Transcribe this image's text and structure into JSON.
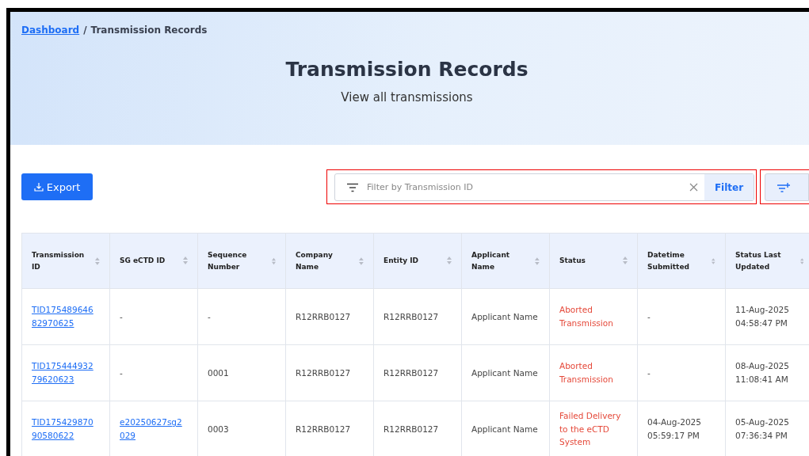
{
  "breadcrumb": {
    "link": "Dashboard",
    "separator": "/",
    "current": "Transmission Records"
  },
  "header": {
    "title": "Transmission Records",
    "subtitle": "View all transmissions"
  },
  "toolbar": {
    "export_label": "Export",
    "search": {
      "placeholder": "Filter by Transmission ID"
    },
    "filter_label": "Filter"
  },
  "table": {
    "columns": [
      {
        "label": "Transmission ID"
      },
      {
        "label": "SG eCTD ID"
      },
      {
        "label": "Sequence Number"
      },
      {
        "label": "Company Name"
      },
      {
        "label": "Entity ID"
      },
      {
        "label": "Applicant Name"
      },
      {
        "label": "Status"
      },
      {
        "label": "Datetime Submitted"
      },
      {
        "label": "Status Last Updated"
      }
    ],
    "rows": [
      {
        "cells": [
          {
            "kind": "link",
            "text": "TID17548964682970625"
          },
          {
            "kind": "text",
            "text": "-"
          },
          {
            "kind": "text",
            "text": "-"
          },
          {
            "kind": "text",
            "text": "R12RRB0127"
          },
          {
            "kind": "text",
            "text": "R12RRB0127"
          },
          {
            "kind": "text",
            "text": "Applicant Name"
          },
          {
            "kind": "status",
            "text": "Aborted Transmission"
          },
          {
            "kind": "text",
            "text": "-"
          },
          {
            "kind": "text",
            "text": "11-Aug-2025 04:58:47 PM"
          }
        ]
      },
      {
        "cells": [
          {
            "kind": "link",
            "text": "TID17544493279620623"
          },
          {
            "kind": "text",
            "text": "-"
          },
          {
            "kind": "text",
            "text": "0001"
          },
          {
            "kind": "text",
            "text": "R12RRB0127"
          },
          {
            "kind": "text",
            "text": "R12RRB0127"
          },
          {
            "kind": "text",
            "text": "Applicant Name"
          },
          {
            "kind": "status",
            "text": "Aborted Transmission"
          },
          {
            "kind": "text",
            "text": "-"
          },
          {
            "kind": "text",
            "text": "08-Aug-2025 11:08:41 AM"
          }
        ]
      },
      {
        "cells": [
          {
            "kind": "link",
            "text": "TID17542987090580622"
          },
          {
            "kind": "link",
            "text": "e20250627sg2029"
          },
          {
            "kind": "text",
            "text": "0003"
          },
          {
            "kind": "text",
            "text": "R12RRB0127"
          },
          {
            "kind": "text",
            "text": "R12RRB0127"
          },
          {
            "kind": "text",
            "text": "Applicant Name"
          },
          {
            "kind": "status",
            "text": "Failed Delivery to the eCTD System"
          },
          {
            "kind": "text",
            "text": "04-Aug-2025 05:59:17 PM"
          },
          {
            "kind": "text",
            "text": "05-Aug-2025 07:36:34 PM"
          }
        ]
      }
    ]
  }
}
